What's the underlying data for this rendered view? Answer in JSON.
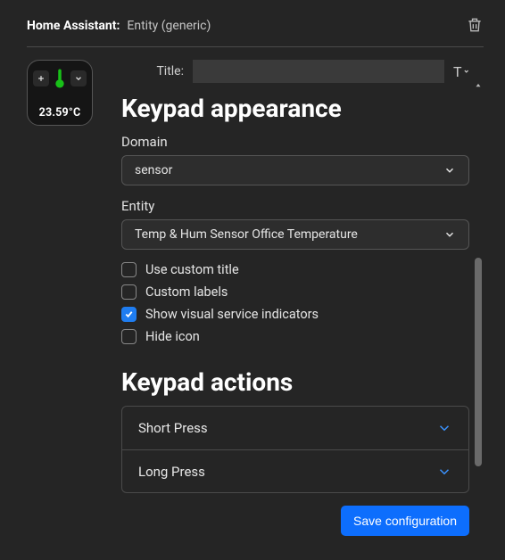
{
  "header": {
    "app_label": "Home Assistant:",
    "subtitle": "Entity (generic)"
  },
  "preview": {
    "value": "23.59°C"
  },
  "title_field": {
    "label": "Title:",
    "value": ""
  },
  "sections": {
    "appearance": "Keypad appearance",
    "actions": "Keypad actions"
  },
  "fields": {
    "domain_label": "Domain",
    "domain_value": "sensor",
    "entity_label": "Entity",
    "entity_value": "Temp & Hum Sensor Office Temperature"
  },
  "checks": {
    "use_custom_title": {
      "label": "Use custom title",
      "checked": false
    },
    "custom_labels": {
      "label": "Custom labels",
      "checked": false
    },
    "show_indicators": {
      "label": "Show visual service indicators",
      "checked": true
    },
    "hide_icon": {
      "label": "Hide icon",
      "checked": false
    }
  },
  "actions": {
    "short": "Short Press",
    "long": "Long Press"
  },
  "footer": {
    "save_label": "Save configuration"
  },
  "scrollbar": {
    "top_pct": 37,
    "height_pct": 46
  },
  "colors": {
    "accent": "#0d6efd",
    "accent_light": "#3b93ff"
  }
}
